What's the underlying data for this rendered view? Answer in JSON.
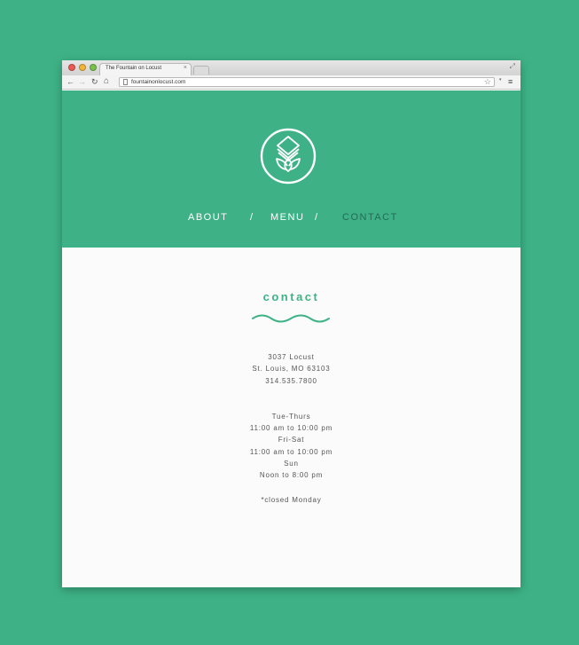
{
  "browser": {
    "tab_title": "The Fountain on Locust",
    "tab_close": "×",
    "url": "fountainonlocust.com"
  },
  "icons": {
    "back": "←",
    "forward": "→",
    "reload": "↻",
    "home": "⌂",
    "star": "☆",
    "menu": "≡",
    "resize": "⤢",
    "menu_arrow": "▾"
  },
  "nav": {
    "about": "ABOUT",
    "separator": "/",
    "menu": "MENU",
    "contact": "CONTACT"
  },
  "contact": {
    "heading": "contact",
    "address_line1": "3037 Locust",
    "address_line2": "St. Louis, MO 63103",
    "phone": "314.535.7800",
    "hours": [
      "Tue-Thurs",
      "11:00 am to 10:00 pm",
      "Fri-Sat",
      "11:00 am to 10:00 pm",
      "Sun",
      "Noon to 8:00 pm"
    ],
    "note": "*closed Monday"
  },
  "colors": {
    "brand_green": "#3eb286",
    "active_nav": "#226b52",
    "page_background": "#fafbfa"
  }
}
